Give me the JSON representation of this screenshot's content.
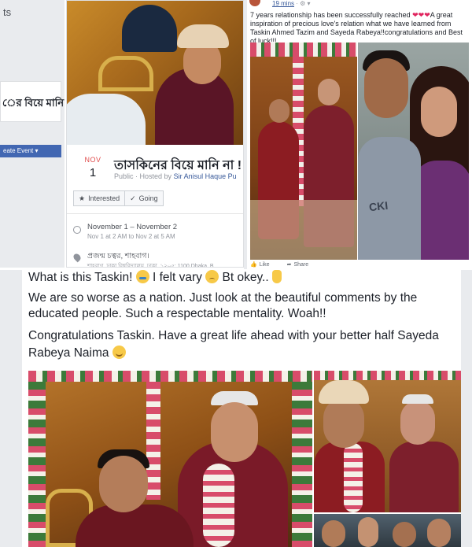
{
  "left_fragment": {
    "title_partial": "ts",
    "card_text": "ের বিয়ে মানি না",
    "create_button": "eate Event ▾"
  },
  "event": {
    "month": "NOV",
    "day": "1",
    "title": "তাসকিনের বিয়ে মানি না !",
    "privacy": "Public",
    "hosted_prefix": "· Hosted by",
    "host": "Sir Anisul Haque Pu",
    "interested_label": "Interested",
    "going_label": "Going",
    "interested_icon": "star-icon",
    "going_icon": "check-icon",
    "date_range": "November 1 – November 2",
    "time_range": "Nov 1 at 2 AM to Nov 2 at 5 AM",
    "location_name": "প্রজন্ম চত্বর, শাহবাগ।",
    "location_address": "শাহবাগ, ঢাকা বিশ্ববিদ্যালয়, ঢাকা, ১২০৫; 1100 Dhaka, B"
  },
  "post_top": {
    "time": "19 mins",
    "audience": "· ⚙ ▾",
    "caption_before_hearts": "7 years relationship has been successfully reached ",
    "hearts": "❤❤❤",
    "caption_after_hearts": "A great inspiration of precious love's relation what we have learned from Taskin Ahmed Tazim and Sayeda Rabeya!!congratulations and Best of luck!!!",
    "shirt_text": "CKI",
    "like_label": "Like",
    "share_label": "Share"
  },
  "post_bottom": {
    "line1_a": "What is this Taskin!",
    "line1_b": " I felt vary ",
    "line1_c": " Bt okey..",
    "line2": "We are so worse as a nation. Just look at the beautiful comments by the",
    "line3": "educated people. Such a respectable mentality. Woah!!",
    "line4": "Congratulations Taskin. Have a great life ahead with your better half Sayeda",
    "line5": "Rabeya Naima"
  }
}
